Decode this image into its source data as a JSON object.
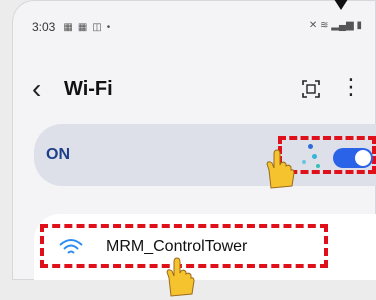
{
  "status_bar": {
    "time": "3:03",
    "icons": [
      "grid-icon",
      "grid-icon",
      "image-icon",
      "dot-icon"
    ],
    "right_icons": [
      "mute-icon",
      "wifi-icon",
      "signal-icon",
      "battery-icon"
    ]
  },
  "header": {
    "back_icon": "chevron-left-icon",
    "title": "Wi-Fi",
    "qr_icon": "qr-scan-icon",
    "more_icon": "more-vert-icon"
  },
  "wifi_toggle": {
    "label": "ON",
    "state": "on",
    "accent": "#2b63e8",
    "highlight": "#e0101a"
  },
  "networks": [
    {
      "ssid": "MRM_ControlTower",
      "icon": "wifi-icon"
    }
  ]
}
